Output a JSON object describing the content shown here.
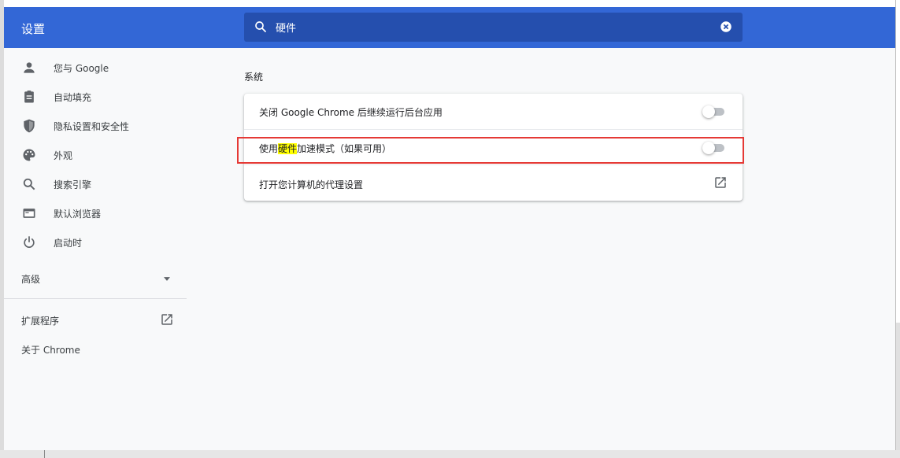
{
  "header": {
    "title": "设置",
    "search_value": "硬件"
  },
  "sidebar": {
    "items": [
      {
        "label": "您与 Google",
        "icon": "person-icon"
      },
      {
        "label": "自动填充",
        "icon": "clipboard-icon"
      },
      {
        "label": "隐私设置和安全性",
        "icon": "shield-icon"
      },
      {
        "label": "外观",
        "icon": "palette-icon"
      },
      {
        "label": "搜索引擎",
        "icon": "search-icon"
      },
      {
        "label": "默认浏览器",
        "icon": "browser-icon"
      },
      {
        "label": "启动时",
        "icon": "power-icon"
      }
    ],
    "advanced_label": "高级",
    "extensions_label": "扩展程序",
    "about_label": "关于 Chrome"
  },
  "main": {
    "section_title": "系统",
    "rows": [
      {
        "label": "关闭 Google Chrome 后继续运行后台应用",
        "toggle_on": false
      },
      {
        "label_before": "使用",
        "label_highlight": "硬件",
        "label_after": "加速模式（如果可用）",
        "toggle_on": false
      },
      {
        "label": "打开您计算机的代理设置"
      }
    ]
  },
  "colors": {
    "header_bg": "#3367d6",
    "search_bg": "#254fae",
    "highlight": "#ffff00",
    "annotation_box": "#e53935"
  }
}
